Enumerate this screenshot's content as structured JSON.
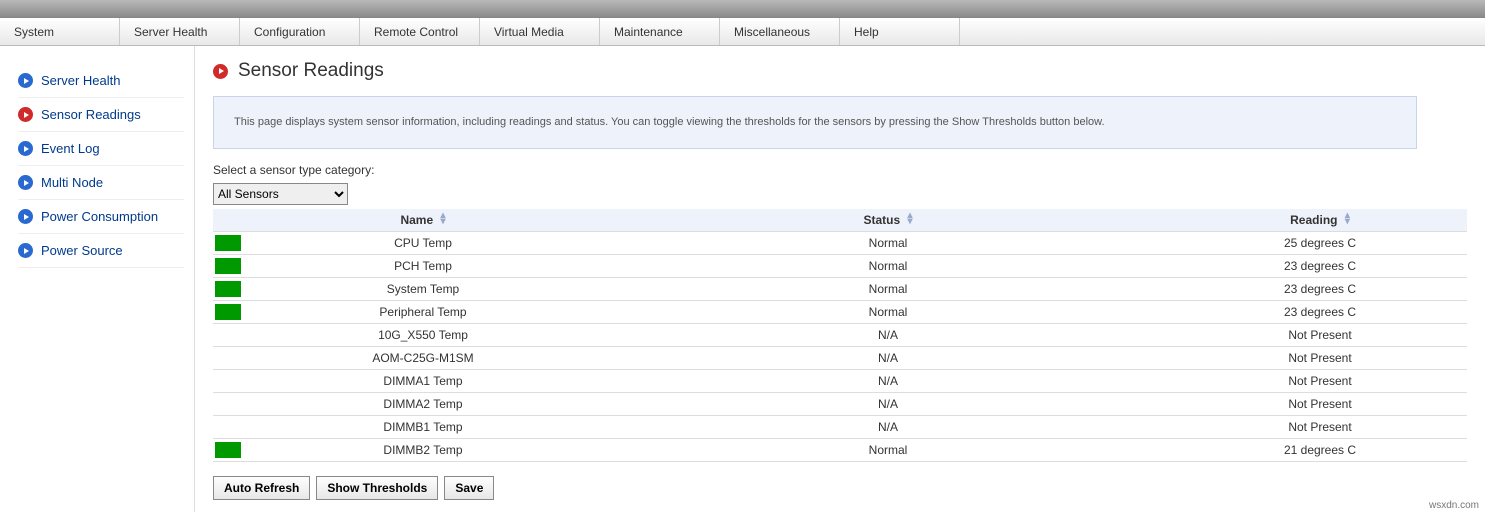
{
  "menubar": {
    "items": [
      "System",
      "Server Health",
      "Configuration",
      "Remote Control",
      "Virtual Media",
      "Maintenance",
      "Miscellaneous",
      "Help"
    ]
  },
  "sidebar": {
    "items": [
      {
        "label": "Server Health",
        "active": false
      },
      {
        "label": "Sensor Readings",
        "active": true
      },
      {
        "label": "Event Log",
        "active": false
      },
      {
        "label": "Multi Node",
        "active": false
      },
      {
        "label": "Power Consumption",
        "active": false
      },
      {
        "label": "Power Source",
        "active": false
      }
    ]
  },
  "page": {
    "title": "Sensor Readings",
    "info": "This page displays system sensor information, including readings and status. You can toggle viewing the thresholds for the sensors by pressing the Show Thresholds button below.",
    "select_label": "Select a sensor type category:",
    "select_value": "All Sensors"
  },
  "table": {
    "headers": {
      "name": "Name",
      "status": "Status",
      "reading": "Reading"
    },
    "rows": [
      {
        "swatch": "green",
        "name": "CPU Temp",
        "status": "Normal",
        "reading": "25 degrees C"
      },
      {
        "swatch": "green",
        "name": "PCH Temp",
        "status": "Normal",
        "reading": "23 degrees C"
      },
      {
        "swatch": "green",
        "name": "System Temp",
        "status": "Normal",
        "reading": "23 degrees C"
      },
      {
        "swatch": "green",
        "name": "Peripheral Temp",
        "status": "Normal",
        "reading": "23 degrees C"
      },
      {
        "swatch": "",
        "name": "10G_X550 Temp",
        "status": "N/A",
        "reading": "Not Present"
      },
      {
        "swatch": "",
        "name": "AOM-C25G-M1SM",
        "status": "N/A",
        "reading": "Not Present"
      },
      {
        "swatch": "",
        "name": "DIMMA1 Temp",
        "status": "N/A",
        "reading": "Not Present"
      },
      {
        "swatch": "",
        "name": "DIMMA2 Temp",
        "status": "N/A",
        "reading": "Not Present"
      },
      {
        "swatch": "",
        "name": "DIMMB1 Temp",
        "status": "N/A",
        "reading": "Not Present"
      },
      {
        "swatch": "green",
        "name": "DIMMB2 Temp",
        "status": "Normal",
        "reading": "21 degrees C"
      }
    ]
  },
  "buttons": {
    "auto_refresh": "Auto Refresh",
    "show_thresholds": "Show Thresholds",
    "save": "Save"
  },
  "watermark": "wsxdn.com"
}
